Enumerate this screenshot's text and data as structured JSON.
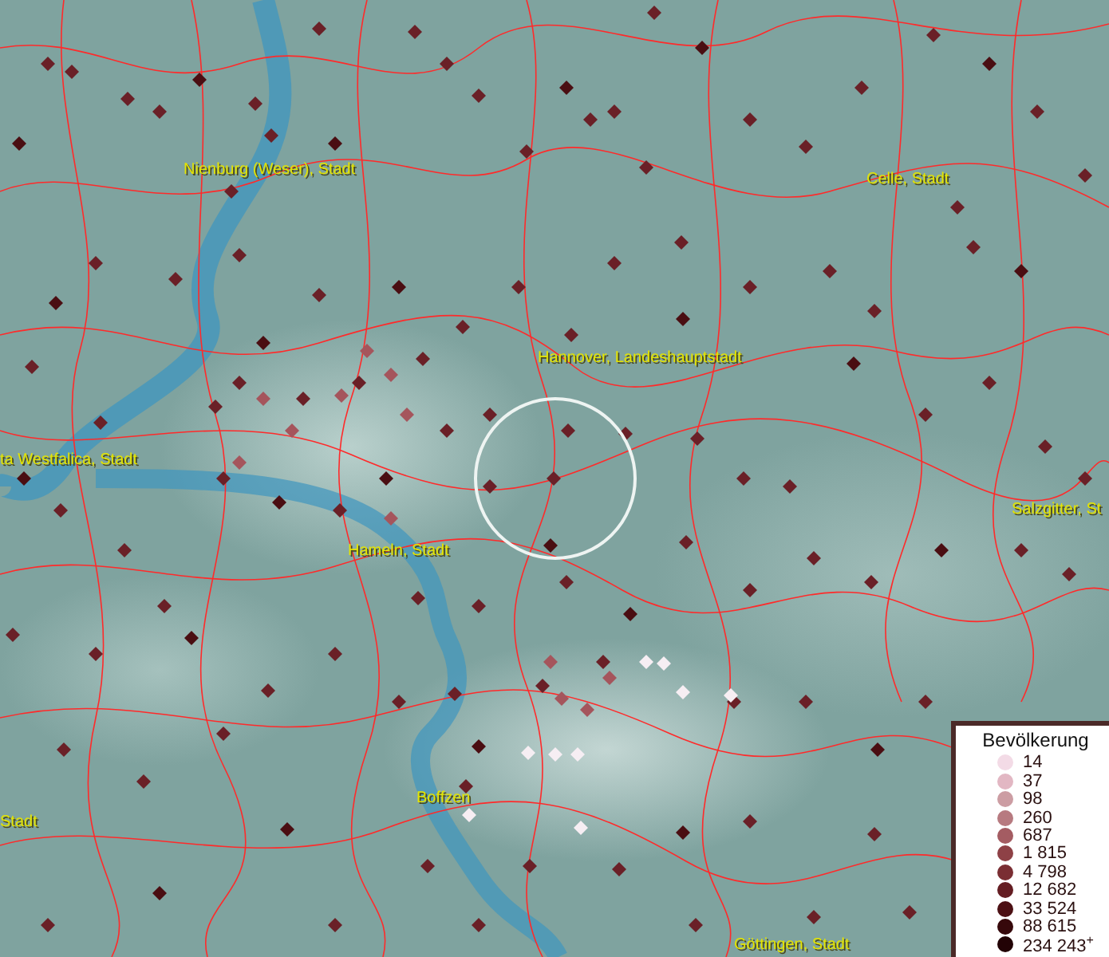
{
  "map": {
    "place_labels": [
      {
        "text": "Nienburg (Weser), Stadt"
      },
      {
        "text": "Celle, Stadt"
      },
      {
        "text": "Hannover, Landeshauptstadt"
      },
      {
        "text": "ta Westfalica, Stadt"
      },
      {
        "text": "Hameln, Stadt"
      },
      {
        "text": "Salzgitter, St"
      },
      {
        "text": "Stadt"
      },
      {
        "text": "Boffzen"
      },
      {
        "text": "Göttingen, Stadt"
      }
    ]
  },
  "legend": {
    "title": "Bevölkerung",
    "entries": [
      {
        "label": "14",
        "color": "#f3dbe6"
      },
      {
        "label": "37",
        "color": "#e2b7c3"
      },
      {
        "label": "98",
        "color": "#cc9da3"
      },
      {
        "label": "260",
        "color": "#b77a80"
      },
      {
        "label": "687",
        "color": "#a45c62"
      },
      {
        "label": "1 815",
        "color": "#8e4146"
      },
      {
        "label": "4 798",
        "color": "#7a2e33"
      },
      {
        "label": "12 682",
        "color": "#641d22"
      },
      {
        "label": "33 524",
        "color": "#4c1014"
      },
      {
        "label": "88 615",
        "color": "#36080b"
      },
      {
        "label": "234 243$^{+}$",
        "color": "#220305"
      }
    ]
  }
}
